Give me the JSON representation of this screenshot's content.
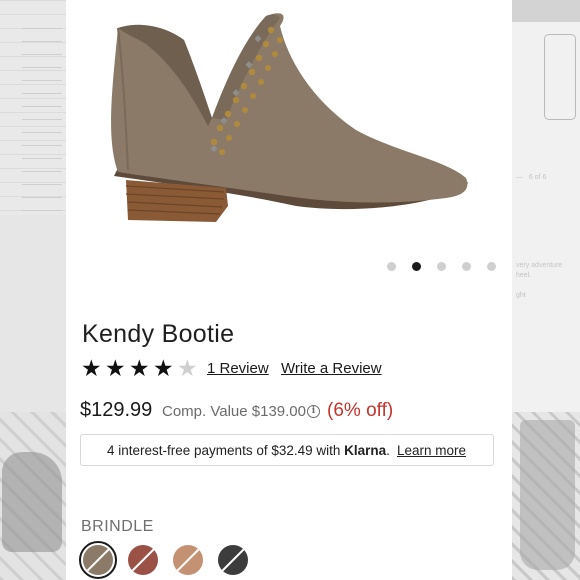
{
  "product": {
    "title": "Kendy Bootie",
    "rating": 4,
    "rating_max": 5,
    "review_link": "1 Review",
    "write_review_link": "Write a Review",
    "price": "$129.99",
    "comp_value": "Comp. Value $139.00",
    "discount": "(6% off)"
  },
  "gallery": {
    "slide_count": 5,
    "active_slide": 2
  },
  "klarna": {
    "text": "4 interest-free payments of $32.49 with ",
    "brand": "Klarna",
    "brand_suffix": ".",
    "learn_more": "Learn more"
  },
  "color": {
    "selected_label": "BRINDLE",
    "swatches": [
      {
        "name": "brindle",
        "hex": "#8b7a68",
        "selected": true
      },
      {
        "name": "rust",
        "hex": "#9c5147",
        "selected": false
      },
      {
        "name": "tan",
        "hex": "#c49272",
        "selected": false
      },
      {
        "name": "black",
        "hex": "#3c3c3c",
        "selected": false
      }
    ]
  },
  "colors": {
    "accent_red": "#c8332b",
    "text_dark": "#1a1a1a",
    "text_gray": "#6b6b6b"
  }
}
